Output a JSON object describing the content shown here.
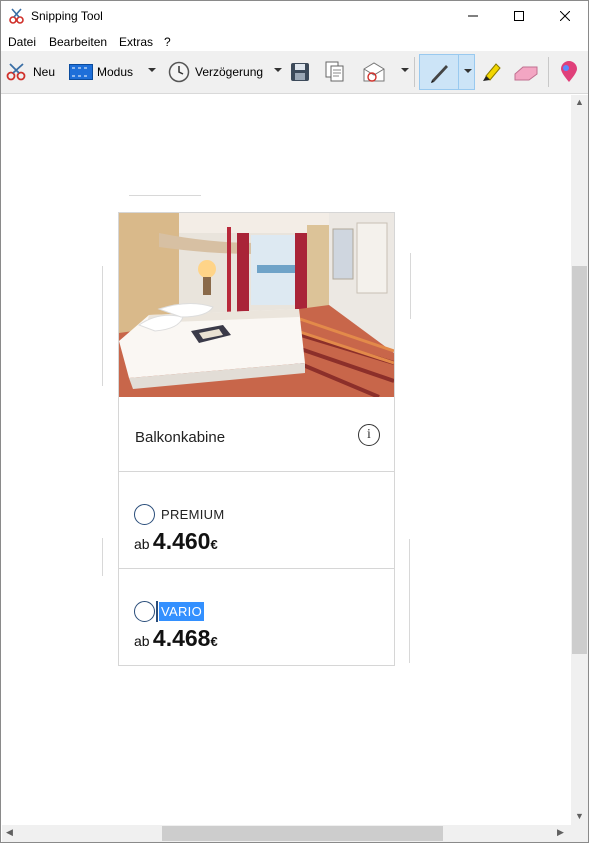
{
  "window": {
    "title": "Snipping Tool"
  },
  "menu": [
    {
      "label": "Datei"
    },
    {
      "label": "Bearbeiten"
    },
    {
      "label": "Extras"
    },
    {
      "label": "?"
    }
  ],
  "toolbar": {
    "new_label": "Neu",
    "mode_label": "Modus",
    "delay_label": "Verzögerung"
  },
  "card": {
    "cabin": "Balkonkabine",
    "options": [
      {
        "label": "PREMIUM",
        "prefix": "ab",
        "amount": "4.460",
        "currency": "€",
        "selected": false
      },
      {
        "label": "VARIO",
        "prefix": "ab",
        "amount": "4.468",
        "currency": "€",
        "selected": false,
        "highlighted": true
      }
    ]
  },
  "colors": {
    "selection": "#3390ff",
    "radio": "#2a4d7a",
    "toolbar_bg": "#f0f0f0",
    "pen_selected": "#cce4f7"
  }
}
